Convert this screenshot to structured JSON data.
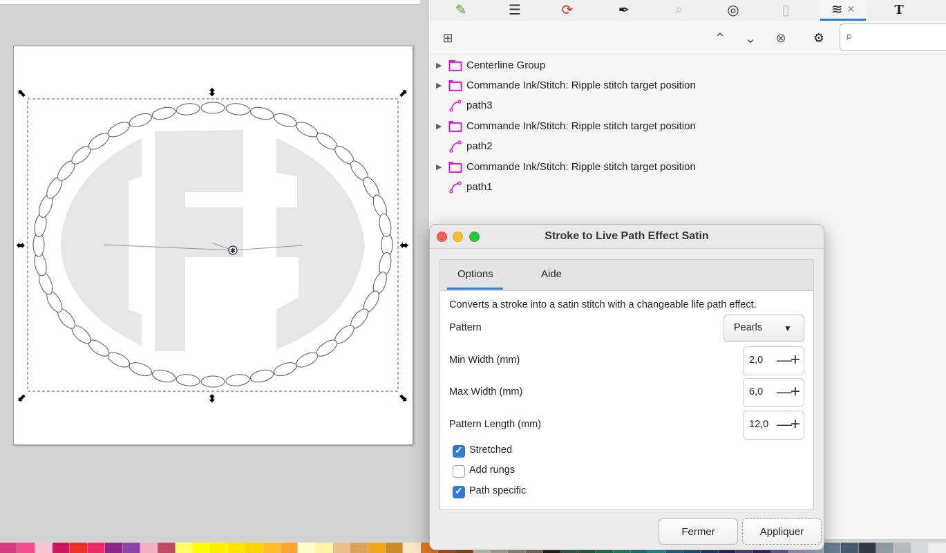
{
  "layers": {
    "items": [
      {
        "label": "Centerline Group",
        "type": "group",
        "expandable": true
      },
      {
        "label": "Commande Ink/Stitch: Ripple stitch target position",
        "type": "group",
        "expandable": true
      },
      {
        "label": "path3",
        "type": "path",
        "expandable": false
      },
      {
        "label": "Commande Ink/Stitch: Ripple stitch target position",
        "type": "group",
        "expandable": true
      },
      {
        "label": "path2",
        "type": "path",
        "expandable": false
      },
      {
        "label": "Commande Ink/Stitch: Ripple stitch target position",
        "type": "group",
        "expandable": true
      },
      {
        "label": "path1",
        "type": "path",
        "expandable": false
      }
    ]
  },
  "dialog": {
    "title": "Stroke to Live Path Effect Satin",
    "tabs": {
      "options": "Options",
      "help": "Aide"
    },
    "description": "Converts a stroke into a satin stitch with a changeable life path effect.",
    "pattern": {
      "label": "Pattern",
      "value": "Pearls"
    },
    "min_width": {
      "label": "Min Width (mm)",
      "value": "2,0"
    },
    "max_width": {
      "label": "Max Width (mm)",
      "value": "6,0"
    },
    "pattern_length": {
      "label": "Pattern Length (mm)",
      "value": "12,0"
    },
    "stretched": {
      "label": "Stretched",
      "checked": true
    },
    "add_rungs": {
      "label": "Add rungs",
      "checked": false
    },
    "path_specific": {
      "label": "Path specific",
      "checked": true
    },
    "close_label": "Fermer",
    "apply_label": "Appliquer"
  },
  "colors": {
    "accent": "#2f7bd8",
    "folder": "#e600e6",
    "selection": "#4a4acb",
    "palette": [
      "#d43c80",
      "#f24d8c",
      "#fbc4d6",
      "#c9195c",
      "#e8322a",
      "#ea2a64",
      "#8a2a86",
      "#8a44a6",
      "#f2b0c4",
      "#c14a60",
      "#ffff66",
      "#ffff00",
      "#fff000",
      "#ffe400",
      "#ffd200",
      "#ffbf2b",
      "#ffa431",
      "#ffffcc",
      "#fff4a6",
      "#e8c088",
      "#d4a45c",
      "#f2a41a",
      "#c88c2a",
      "#ffe6c8",
      "#e87d1e",
      "#c85c1c",
      "#9c5528",
      "#e2e2d2",
      "#ccc0aa",
      "#aa9e88",
      "#8a7a64",
      "#2a241c",
      "#46665a",
      "#2e6e46",
      "#1a8a56",
      "#1e9c7a",
      "#148c8c",
      "#1eaaa0",
      "#1a7a9c",
      "#225e8a",
      "#2a4478",
      "#2a2e64",
      "#5a4e8c",
      "#3c2e5c",
      "#7a6aa6",
      "#b0aacc",
      "#a6b8cc",
      "#6a7e96",
      "#4a5a6e",
      "#323a46",
      "#8e9a9e",
      "#b6bcbe",
      "#d6dadc",
      "#eeeeee"
    ]
  }
}
